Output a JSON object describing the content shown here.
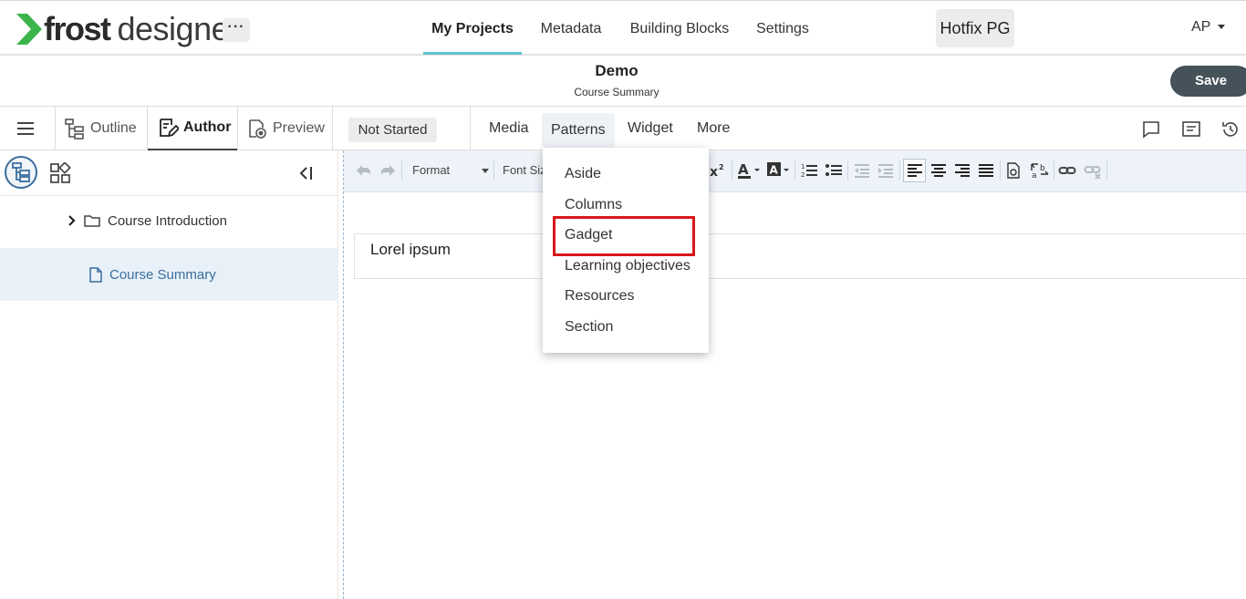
{
  "app": {
    "logo_bold": "frost",
    "logo_light": "designer",
    "more_label": "···",
    "colors": {
      "accent": "#5ec4cf",
      "logo_green": "#3bb54a",
      "primary_dark": "#45525a",
      "link_blue": "#3a6e9e",
      "highlight_red": "#d8161a"
    }
  },
  "nav": {
    "items": [
      {
        "label": "My Projects",
        "active": true
      },
      {
        "label": "Metadata"
      },
      {
        "label": "Building Blocks"
      },
      {
        "label": "Settings"
      }
    ],
    "project": "Hotfix PG",
    "user": "AP"
  },
  "header": {
    "title": "Demo",
    "subtitle": "Course Summary",
    "save_label": "Save"
  },
  "modes": {
    "outline": "Outline",
    "author": "Author",
    "preview": "Preview",
    "status": "Not Started",
    "menu": [
      "Media",
      "Patterns",
      "Widget",
      "More"
    ]
  },
  "sidebar": {
    "items": [
      {
        "label": "Course Introduction",
        "icon": "folder-icon"
      },
      {
        "label": "Course Summary",
        "icon": "page-icon",
        "selected": true
      }
    ]
  },
  "toolbar": {
    "format_label": "Format",
    "font_size_label": "Font Size"
  },
  "editor": {
    "content": "Lorel ipsum"
  },
  "patterns_menu": {
    "items": [
      "Aside",
      "Columns",
      "Gadget",
      "Learning objectives",
      "Resources",
      "Section"
    ],
    "highlighted": "Gadget"
  }
}
